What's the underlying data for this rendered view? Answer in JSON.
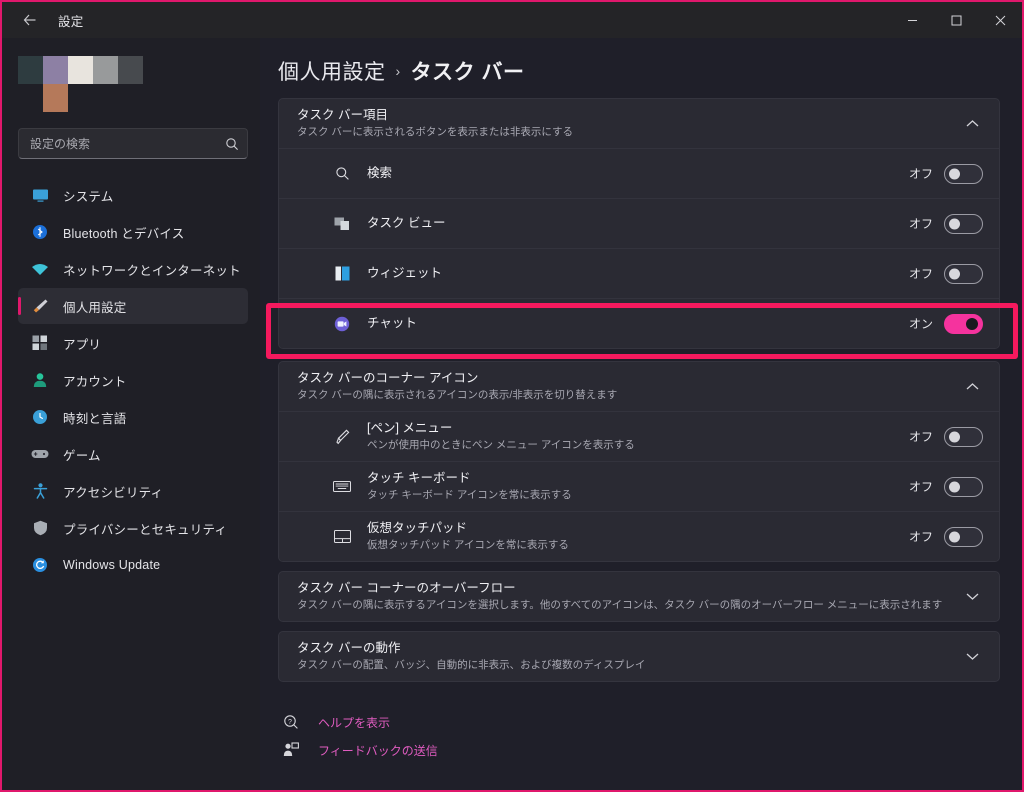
{
  "window": {
    "title": "設定",
    "back_icon": "back-arrow-icon",
    "controls": {
      "minimize": "―",
      "maximize": "▢",
      "close": "✕"
    },
    "border_color": "#e0186c"
  },
  "sidebar": {
    "mosaic_colors": [
      "#2e3c40",
      "#8d80a4",
      "#e8e4de",
      "#989a9b",
      "#474a4e",
      "#b5795a"
    ],
    "search": {
      "placeholder": "設定の検索",
      "value": "",
      "icon": "search-icon"
    },
    "items": [
      {
        "label": "システム",
        "icon": "monitor-icon",
        "active": false
      },
      {
        "label": "Bluetooth とデバイス",
        "icon": "bluetooth-icon",
        "active": false
      },
      {
        "label": "ネットワークとインターネット",
        "icon": "wifi-icon",
        "active": false
      },
      {
        "label": "個人用設定",
        "icon": "paintbrush-icon",
        "active": true
      },
      {
        "label": "アプリ",
        "icon": "apps-icon",
        "active": false
      },
      {
        "label": "アカウント",
        "icon": "account-icon",
        "active": false
      },
      {
        "label": "時刻と言語",
        "icon": "clock-icon",
        "active": false
      },
      {
        "label": "ゲーム",
        "icon": "gamepad-icon",
        "active": false
      },
      {
        "label": "アクセシビリティ",
        "icon": "accessibility-icon",
        "active": false
      },
      {
        "label": "プライバシーとセキュリティ",
        "icon": "shield-icon",
        "active": false
      },
      {
        "label": "Windows Update",
        "icon": "update-icon",
        "active": false
      }
    ],
    "accent_color": "#e0186c"
  },
  "breadcrumb": {
    "root": "個人用設定",
    "separator": "›",
    "current": "タスク バー"
  },
  "sections": {
    "taskbar_items": {
      "title": "タスク バー項目",
      "subtitle": "タスク バーに表示されるボタンを表示または非表示にする",
      "chevron": "chevron-up-icon",
      "rows": [
        {
          "label": "検索",
          "icon": "search-glyph-icon",
          "state_label": "オフ",
          "on": false
        },
        {
          "label": "タスク ビュー",
          "icon": "task-view-icon",
          "state_label": "オフ",
          "on": false
        },
        {
          "label": "ウィジェット",
          "icon": "widgets-icon",
          "state_label": "オフ",
          "on": false
        },
        {
          "label": "チャット",
          "icon": "chat-icon",
          "state_label": "オン",
          "on": true,
          "highlighted": true
        }
      ]
    },
    "corner_icons": {
      "title": "タスク バーのコーナー アイコン",
      "subtitle": "タスク バーの隅に表示されるアイコンの表示/非表示を切り替えます",
      "chevron": "chevron-up-icon",
      "rows": [
        {
          "label": "[ペン] メニュー",
          "desc": "ペンが使用中のときにペン メニュー アイコンを表示する",
          "icon": "pen-icon",
          "state_label": "オフ",
          "on": false
        },
        {
          "label": "タッチ キーボード",
          "desc": "タッチ キーボード アイコンを常に表示する",
          "icon": "keyboard-icon",
          "state_label": "オフ",
          "on": false
        },
        {
          "label": "仮想タッチパッド",
          "desc": "仮想タッチパッド アイコンを常に表示する",
          "icon": "touchpad-icon",
          "state_label": "オフ",
          "on": false
        }
      ]
    },
    "corner_overflow": {
      "title": "タスク バー コーナーのオーバーフロー",
      "subtitle": "タスク バーの隅に表示するアイコンを選択します。他のすべてのアイコンは、タスク バーの隅のオーバーフロー メニューに表示されます",
      "chevron": "chevron-down-icon"
    },
    "taskbar_behavior": {
      "title": "タスク バーの動作",
      "subtitle": "タスク バーの配置、バッジ、自動的に非表示、および複数のディスプレイ",
      "chevron": "chevron-down-icon"
    }
  },
  "footer_links": [
    {
      "label": "ヘルプを表示",
      "icon": "help-icon"
    },
    {
      "label": "フィードバックの送信",
      "icon": "feedback-icon"
    }
  ],
  "colors": {
    "accent_pink": "#e0186c",
    "highlight_box": "#f5195e",
    "toggle_on": "#f5339e",
    "link": "#e05cc0",
    "page_bg": "#1f1f29",
    "card_bg": "#2a2a33"
  }
}
